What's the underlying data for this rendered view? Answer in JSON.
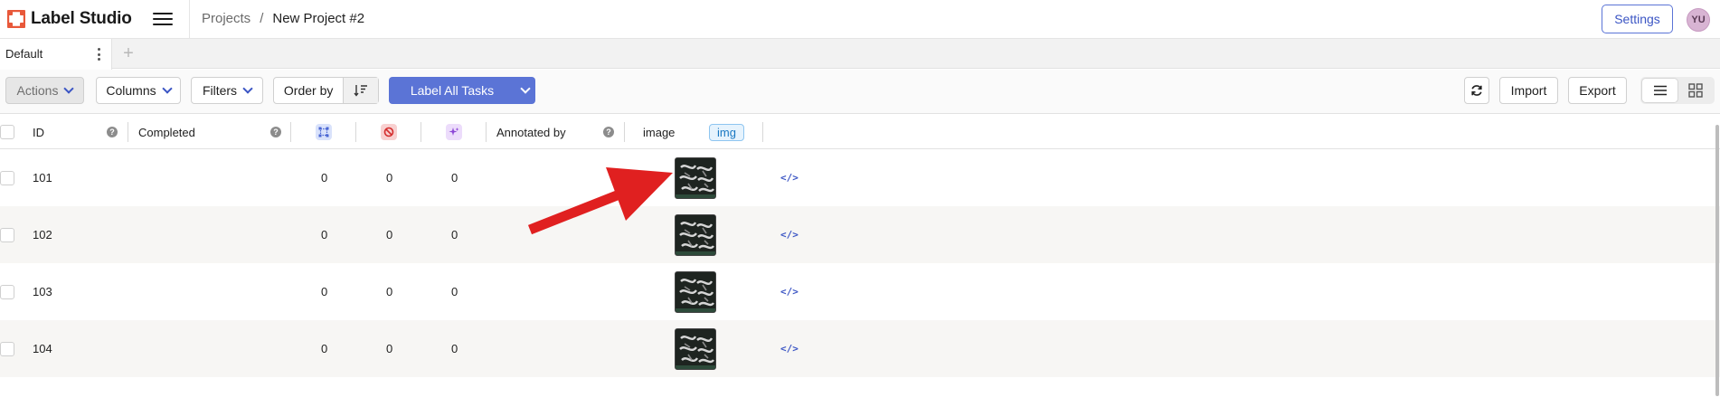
{
  "header": {
    "app_name": "Label Studio",
    "breadcrumb": {
      "root": "Projects",
      "separator": "/",
      "current": "New Project #2"
    },
    "settings_label": "Settings",
    "avatar_initials": "YU",
    "brand_color": "#e8583a"
  },
  "tabs": {
    "active": "Default",
    "add_symbol": "+"
  },
  "toolbar": {
    "actions": "Actions",
    "columns": "Columns",
    "filters": "Filters",
    "order_by": "Order by",
    "label_all": "Label All Tasks",
    "import": "Import",
    "export": "Export",
    "accent": "#5b74d6"
  },
  "table": {
    "columns": {
      "id": "ID",
      "completed": "Completed",
      "annotations_icon": "annotations-icon",
      "cancelled_icon": "cancelled-icon",
      "predictions_icon": "predictions-icon",
      "annotated_by": "Annotated by",
      "image": "image",
      "image_chip": "img",
      "help": "?"
    },
    "rows": [
      {
        "id": "101",
        "annotations": "0",
        "cancelled": "0",
        "predictions": "0",
        "source": "</>"
      },
      {
        "id": "102",
        "annotations": "0",
        "cancelled": "0",
        "predictions": "0",
        "source": "</>"
      },
      {
        "id": "103",
        "annotations": "0",
        "cancelled": "0",
        "predictions": "0",
        "source": "</>"
      },
      {
        "id": "104",
        "annotations": "0",
        "cancelled": "0",
        "predictions": "0",
        "source": "</>"
      }
    ]
  },
  "annotation_arrow_color": "#e02020"
}
